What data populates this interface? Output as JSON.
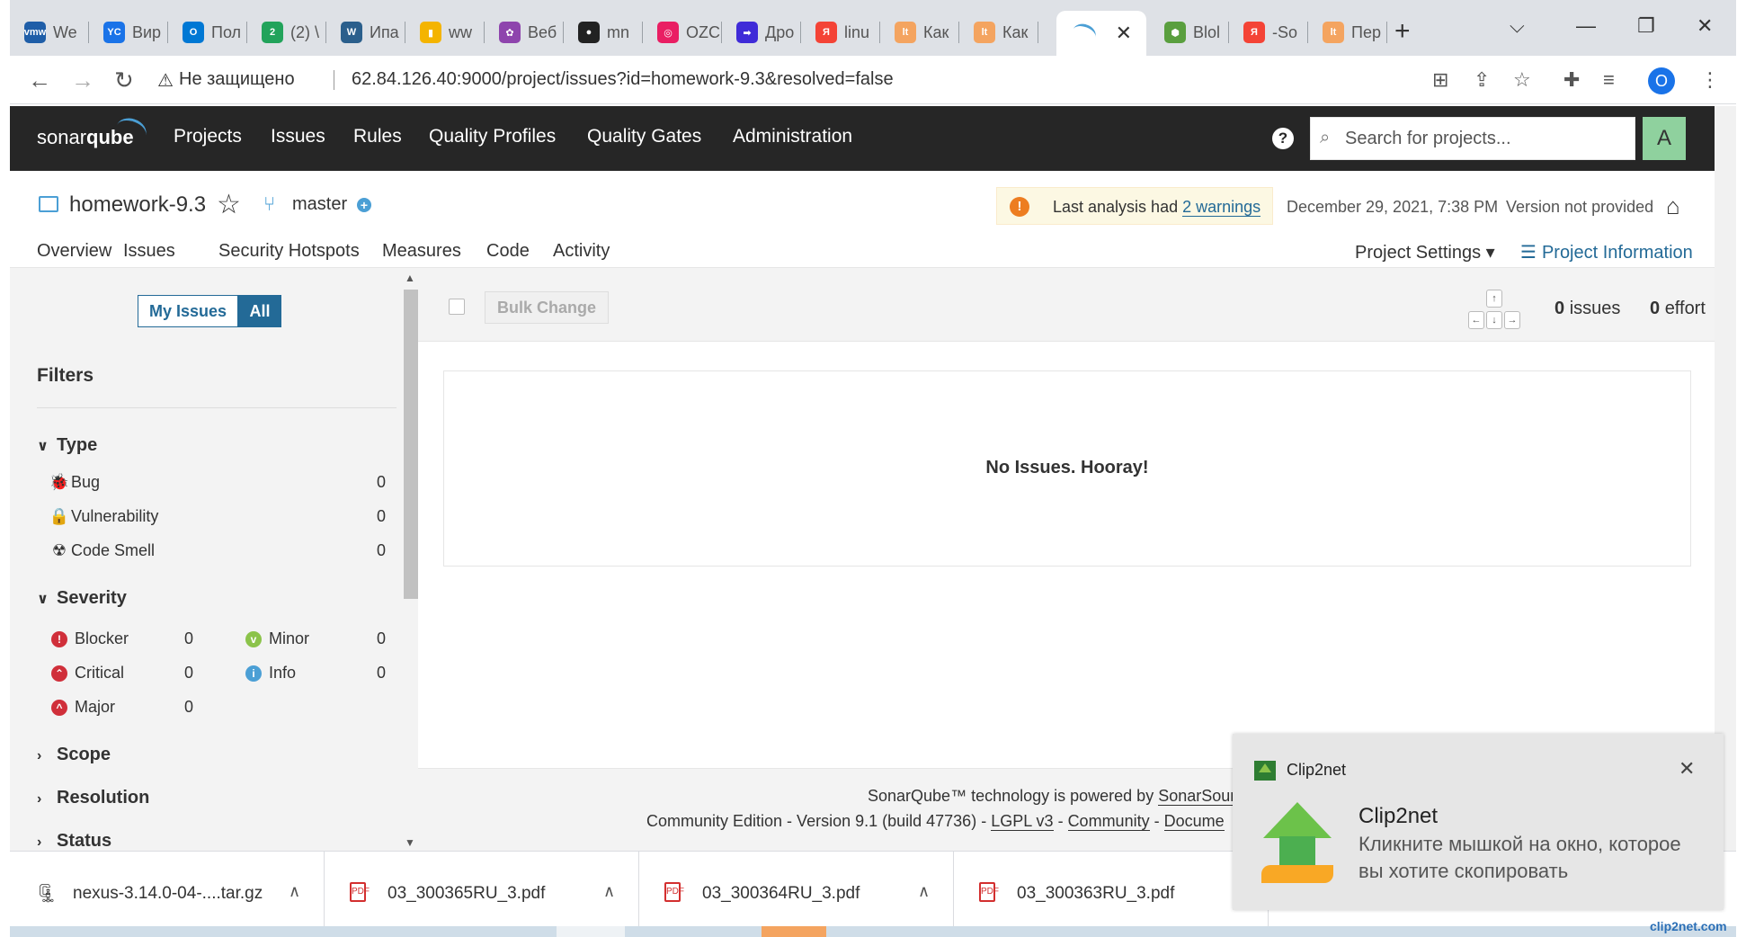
{
  "browser": {
    "tabs": [
      {
        "label": "We",
        "color": "#1f5ea8",
        "glyph": "vmw"
      },
      {
        "label": "Вир",
        "color": "#1a73e8",
        "glyph": "YC"
      },
      {
        "label": "Пол",
        "color": "#0078d4",
        "glyph": "O"
      },
      {
        "label": "(2) \\",
        "color": "#22a35b",
        "glyph": "2"
      },
      {
        "label": "Ипа",
        "color": "#2b5f8c",
        "glyph": "W"
      },
      {
        "label": "ww",
        "color": "#f4b400",
        "glyph": "▮"
      },
      {
        "label": "Веб",
        "color": "#8e44ad",
        "glyph": "✿"
      },
      {
        "label": "mn",
        "color": "#222222",
        "glyph": "●"
      },
      {
        "label": "OZC",
        "color": "#e91e63",
        "glyph": "◎"
      },
      {
        "label": "Дро",
        "color": "#3f2bd8",
        "glyph": "➡"
      },
      {
        "label": "linu",
        "color": "#f44336",
        "glyph": "Я"
      },
      {
        "label": "Как",
        "color": "#f4a460",
        "glyph": "lt"
      },
      {
        "label": "Как",
        "color": "#f4a460",
        "glyph": "lt"
      },
      {
        "label": "Blol",
        "color": "#5a9f3f",
        "glyph": "⬢"
      },
      {
        "label": "-So",
        "color": "#f44336",
        "glyph": "Я"
      },
      {
        "label": "Пер",
        "color": "#f4a460",
        "glyph": "lt"
      }
    ],
    "active_tab_close": "✕",
    "new_tab": "+",
    "window_controls": {
      "tab_search": "⌵",
      "minimize": "—",
      "restore": "❐",
      "close": "✕"
    },
    "nav": {
      "back": "←",
      "forward": "→",
      "reload": "↻"
    },
    "security_label": "Не защищено",
    "url": "62.84.126.40:9000/project/issues?id=homework-9.3&resolved=false",
    "profile_initial": "O"
  },
  "sonar": {
    "logo_text": "sonar",
    "logo_bold": "qube",
    "nav": [
      "Projects",
      "Issues",
      "Rules",
      "Quality Profiles",
      "Quality Gates",
      "Administration"
    ],
    "help": "?",
    "search_placeholder": "Search for projects...",
    "avatar_initial": "A"
  },
  "project": {
    "name": "homework-9.3",
    "branch": "master",
    "warning_prefix": "Last analysis had ",
    "warning_link": "2 warnings",
    "analysis_date": "December 29, 2021, 7:38 PM",
    "version": "Version not provided",
    "tabs": [
      "Overview",
      "Issues",
      "Security Hotspots",
      "Measures",
      "Code",
      "Activity"
    ],
    "settings": "Project Settings ▾",
    "information": "Project Information"
  },
  "filters": {
    "my_issues": "My Issues",
    "all": "All",
    "title": "Filters",
    "type": {
      "header": "Type",
      "items": [
        {
          "label": "Bug",
          "count": "0"
        },
        {
          "label": "Vulnerability",
          "count": "0"
        },
        {
          "label": "Code Smell",
          "count": "0"
        }
      ]
    },
    "severity": {
      "header": "Severity",
      "items": [
        {
          "label": "Blocker",
          "count": "0",
          "color": "#d02f3a"
        },
        {
          "label": "Critical",
          "count": "0",
          "color": "#d02f3a"
        },
        {
          "label": "Major",
          "count": "0",
          "color": "#d02f3a"
        },
        {
          "label": "Minor",
          "count": "0",
          "color": "#8bc34a"
        },
        {
          "label": "Info",
          "count": "0",
          "color": "#4b9fd5"
        }
      ]
    },
    "collapsed": [
      "Scope",
      "Resolution",
      "Status"
    ]
  },
  "main": {
    "bulk_change": "Bulk Change",
    "keys": {
      "up": "↑",
      "left": "←",
      "down": "↓",
      "right": "→"
    },
    "issues_count": "0",
    "issues_label": "issues",
    "effort_count": "0",
    "effort_label": "effort",
    "empty_message": "No Issues. Hooray!",
    "footer_line1": "SonarQube™ technology is powered by ",
    "footer_line1_link": "SonarSour",
    "footer_edition": "Community Edition - Version 9.1 (build 47736) - ",
    "footer_license": "LGPL v3",
    "footer_sep": " - ",
    "footer_community": "Community",
    "footer_docs": "Docume"
  },
  "downloads": [
    {
      "name": "nexus-3.14.0-04-....tar.gz",
      "type": "archive"
    },
    {
      "name": "03_300365RU_3.pdf",
      "type": "pdf"
    },
    {
      "name": "03_300364RU_3.pdf",
      "type": "pdf"
    },
    {
      "name": "03_300363RU_3.pdf",
      "type": "pdf"
    }
  ],
  "notification": {
    "app": "Clip2net",
    "title": "Clip2net",
    "message": "Кликните мышкой на окно, которое вы хотите скопировать",
    "close": "✕",
    "brand": "clip2net.com"
  },
  "colors": {
    "accent": "#4b9fd5",
    "link": "#236a97",
    "nav_bg": "#262626",
    "warning": "#ed7d20"
  }
}
